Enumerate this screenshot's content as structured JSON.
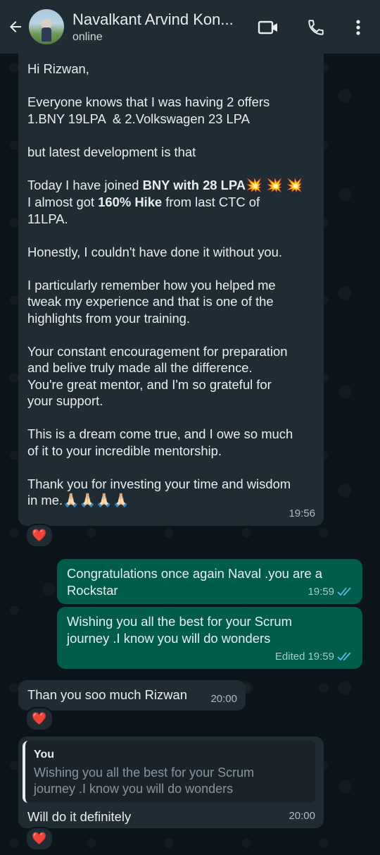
{
  "header": {
    "contact_name": "Navalkant Arvind Kon...",
    "status": "online",
    "icons": [
      "back-arrow-icon",
      "video-call-icon",
      "phone-call-icon",
      "more-options-icon"
    ]
  },
  "messages": [
    {
      "direction": "incoming",
      "lines_a": "Hi Rizwan,\n\nEveryone knows that I was having 2 offers\n1.BNY 19LPA  & 2.Volkswagen 23 LPA\n\nbut latest development is that\n\n",
      "today_prefix": "Today I have joined ",
      "today_bold": "BNY with 28 LPA",
      "today_emoji": "💥 💥 💥",
      "hike_prefix": "I almost got ",
      "hike_bold": "160% Hike",
      "hike_suffix": " from last CTC of\n11LPA.",
      "lines_b": "\n\nHonestly, I couldn't have done it without you.\n\nI particularly remember how you helped me\ntweak my experience and that is one of the\nhighlights from your training.\n\nYour constant encouragement for preparation\nand belive truly made all the difference.\nYou're great mentor, and I'm so grateful for\nyour support.\n\nThis is a dream come true, and I owe so much\nof it to your incredible mentorship.\n\nThank you for investing your time and wisdom\nin me.",
      "closing_emoji": "🙏🏻🙏🏻🙏🏻🙏🏻",
      "time": "19:56",
      "reaction": "❤️"
    },
    {
      "direction": "outgoing",
      "text": "Congratulations once again Naval .you are a\nRockstar",
      "time": "19:59"
    },
    {
      "direction": "outgoing",
      "text": "Wishing you all the best for your Scrum\njourney .I know you will do wonders",
      "edited": "Edited",
      "time": "19:59"
    },
    {
      "direction": "incoming",
      "text": "Than you soo much Rizwan",
      "time": "20:00",
      "reaction": "❤️"
    },
    {
      "direction": "incoming",
      "quote_author": "You",
      "quote_text": "Wishing you all the best for your Scrum\njourney .I know you will do wonders",
      "text": "Will do it definitely",
      "time": "20:00",
      "reaction": "❤️"
    }
  ],
  "colors": {
    "header_bg": "#1f2c34",
    "chat_bg": "#0b141a",
    "incoming_bubble": "#1f2c34",
    "outgoing_bubble": "#005c4b",
    "read_ticks": "#53bdeb"
  }
}
